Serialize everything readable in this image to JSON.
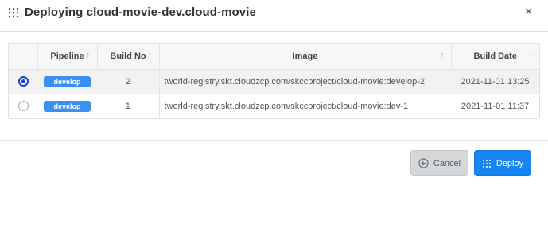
{
  "dialog": {
    "title": "Deploying cloud-movie-dev.cloud-movie",
    "close_label": "×"
  },
  "table": {
    "headers": {
      "pipeline": "Pipeline",
      "build_no": "Build No",
      "image": "Image",
      "build_date": "Build Date"
    },
    "rows": [
      {
        "selected": true,
        "pipeline": "develop",
        "build_no": "2",
        "image": "tworld-registry.skt.cloudzcp.com/skccproject/cloud-movie:develop-2",
        "build_date": "2021-11-01 13:25"
      },
      {
        "selected": false,
        "pipeline": "develop",
        "build_no": "1",
        "image": "tworld-registry.skt.cloudzcp.com/skccproject/cloud-movie:dev-1",
        "build_date": "2021-11-01 11:37"
      }
    ]
  },
  "buttons": {
    "cancel_label": "Cancel",
    "deploy_label": "Deploy"
  },
  "colors": {
    "accent": "#1785f2",
    "badge": "#3a8ff0",
    "radio_selected": "#1a3fd1"
  },
  "icons": {
    "title": "grid-dots-icon",
    "close": "close-icon",
    "cancel": "arrow-left-circle-icon",
    "deploy": "grid-dots-icon",
    "sort": "sort-arrow-icon"
  }
}
